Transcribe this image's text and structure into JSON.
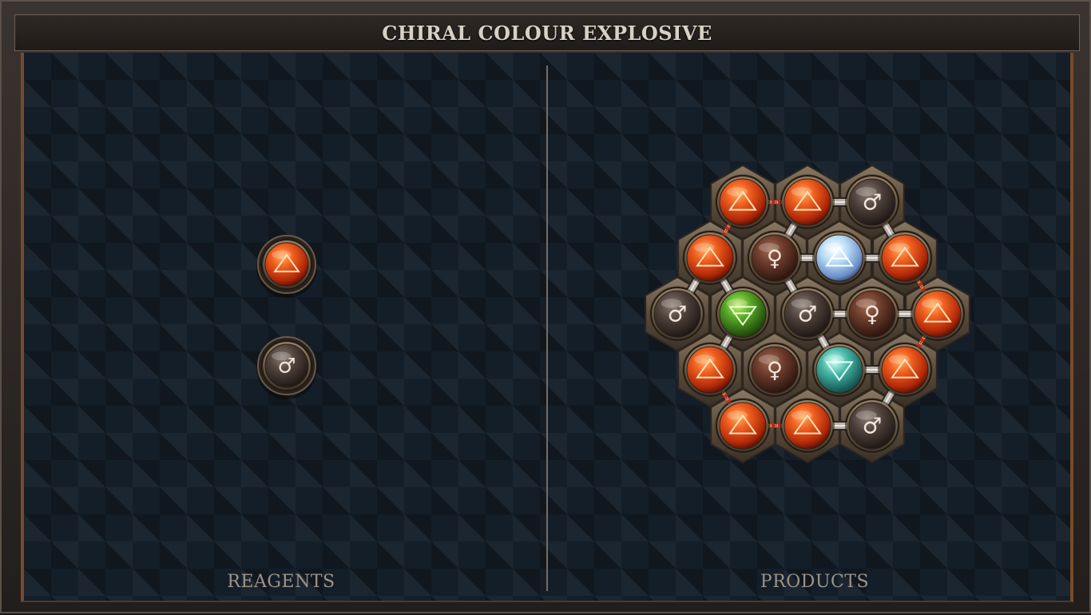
{
  "title": "CHIRAL COLOUR EXPLOSIVE",
  "panels": {
    "reagents_label": "REAGENTS",
    "products_label": "PRODUCTS"
  },
  "colors": {
    "fire": "#e0501a",
    "salt": "#4a3a34",
    "vitae": "#6a3a28",
    "air": "#a8d0f0",
    "earth": "#4aa030",
    "water": "#40b0a8"
  },
  "elements": {
    "fire": {
      "symbol": "△",
      "icon": "fire-icon"
    },
    "iron": {
      "symbol": "♂",
      "icon": "iron-icon"
    },
    "copper": {
      "symbol": "♀",
      "icon": "copper-icon"
    },
    "air": {
      "symbol": "△",
      "icon": "air-icon"
    },
    "earth": {
      "symbol": "∀",
      "icon": "earth-icon"
    },
    "water": {
      "symbol": "▽",
      "icon": "water-icon"
    }
  },
  "reagents": [
    {
      "element": "fire"
    },
    {
      "element": "iron"
    }
  ],
  "product": {
    "atoms": [
      {
        "element": "fire"
      },
      {
        "element": "fire"
      },
      {
        "element": "iron"
      },
      {
        "element": "fire"
      },
      {
        "element": "copper"
      },
      {
        "element": "air"
      },
      {
        "element": "fire"
      },
      {
        "element": "iron"
      },
      {
        "element": "earth"
      },
      {
        "element": "iron"
      },
      {
        "element": "copper"
      },
      {
        "element": "fire"
      },
      {
        "element": "fire"
      },
      {
        "element": "copper"
      },
      {
        "element": "water"
      },
      {
        "element": "fire"
      },
      {
        "element": "fire"
      },
      {
        "element": "fire"
      },
      {
        "element": "iron"
      }
    ]
  }
}
